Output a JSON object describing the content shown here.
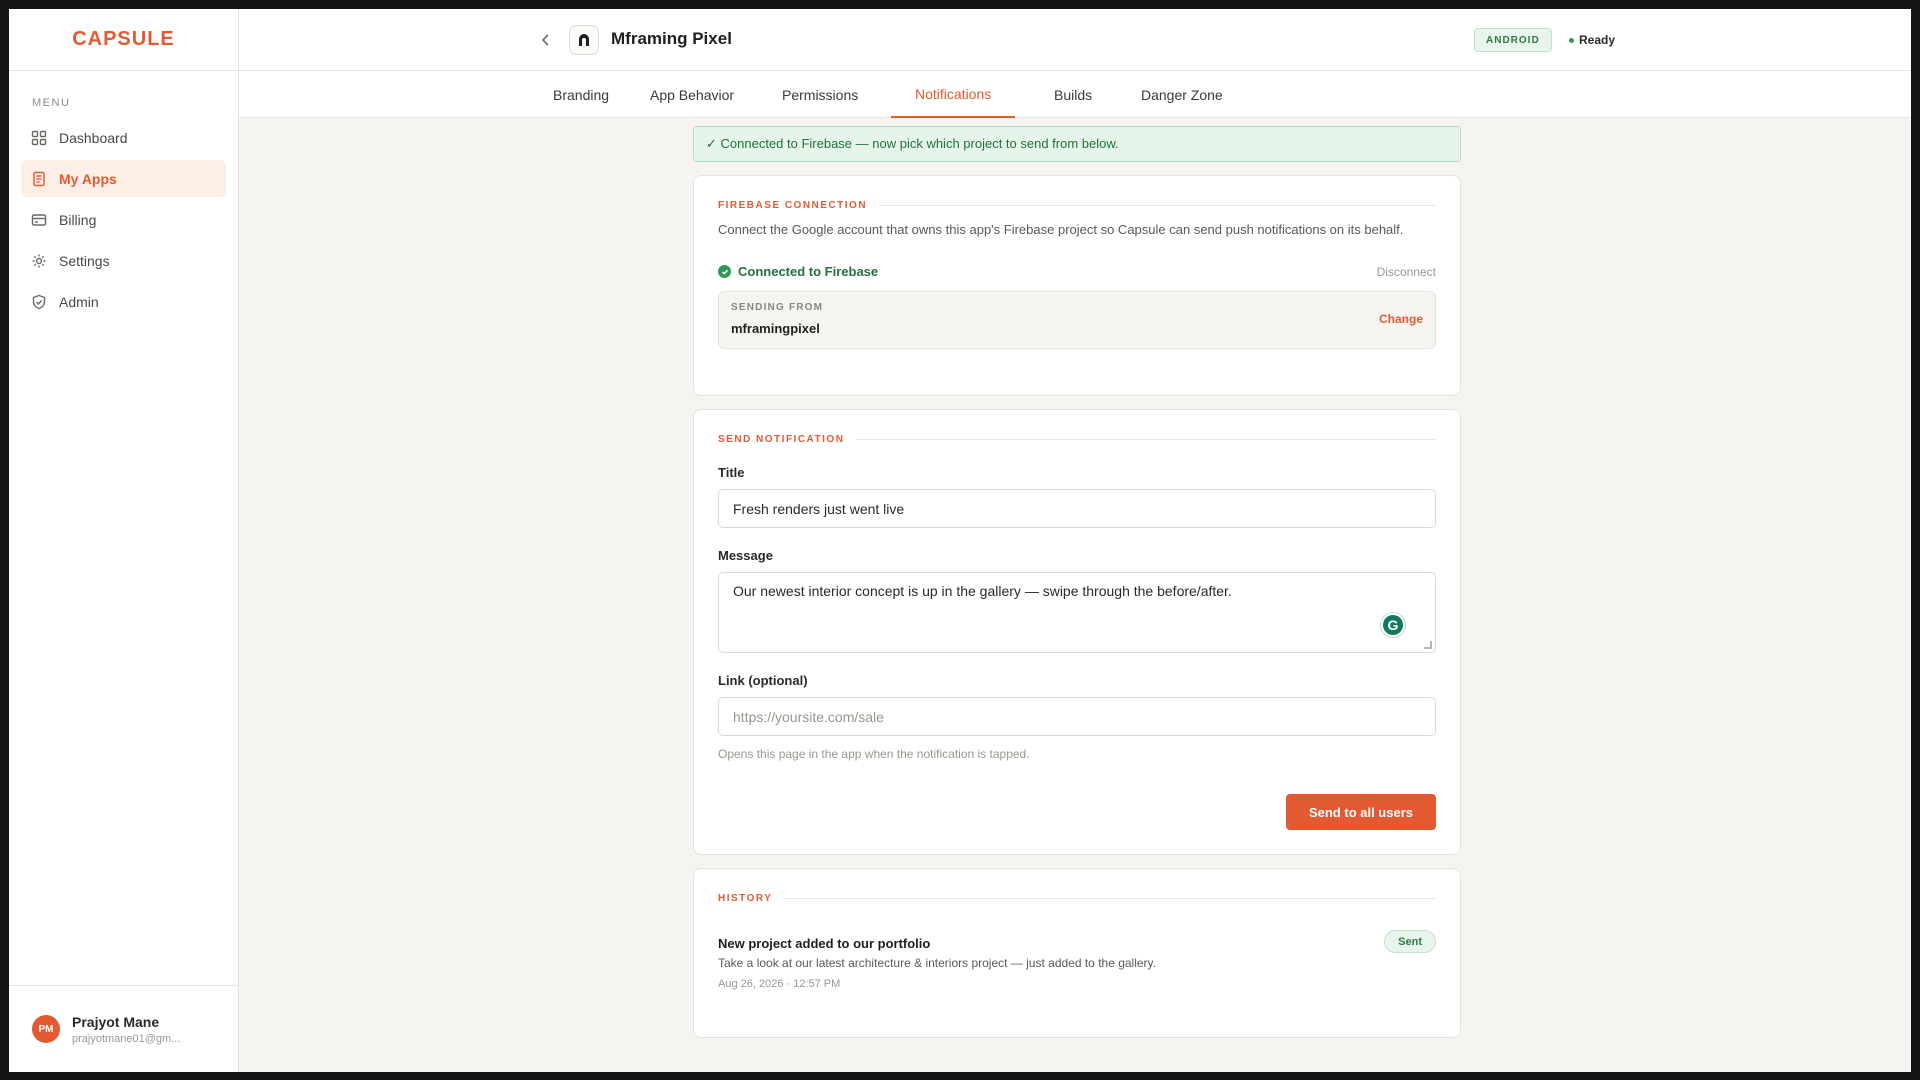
{
  "brand": "CAPSULE",
  "sidebar": {
    "menu_label": "MENU",
    "items": [
      {
        "label": "Dashboard",
        "icon": "grid-icon"
      },
      {
        "label": "My Apps",
        "icon": "document-icon"
      },
      {
        "label": "Billing",
        "icon": "card-icon"
      },
      {
        "label": "Settings",
        "icon": "gear-icon"
      },
      {
        "label": "Admin",
        "icon": "shield-icon"
      }
    ],
    "active": "My Apps",
    "user": {
      "initials": "PM",
      "name": "Prajyot Mane",
      "email": "prajyotmane01@gm..."
    }
  },
  "header": {
    "app_name": "Mframing Pixel",
    "platform": "ANDROID",
    "status": "Ready"
  },
  "tabs": [
    "Branding",
    "App Behavior",
    "Permissions",
    "Notifications",
    "Builds",
    "Danger Zone"
  ],
  "active_tab": "Notifications",
  "banner": "✓ Connected to Firebase — now pick which project to send from below.",
  "firebase": {
    "section_title": "FIREBASE CONNECTION",
    "description": "Connect the Google account that owns this app's Firebase project so Capsule can send push notifications on its behalf.",
    "connected_label": "Connected to Firebase",
    "disconnect_label": "Disconnect",
    "sending_from_label": "SENDING FROM",
    "sending_from_value": "mframingpixel",
    "change_label": "Change"
  },
  "send": {
    "section_title": "SEND NOTIFICATION",
    "title_label": "Title",
    "title_value": "Fresh renders just went live",
    "message_label": "Message",
    "message_value": "Our newest interior concept is up in the gallery — swipe through the before/after.",
    "link_label": "Link (optional)",
    "link_placeholder": "https://yoursite.com/sale",
    "link_hint": "Opens this page in the app when the notification is tapped.",
    "button_label": "Send to all users"
  },
  "history": {
    "section_title": "HISTORY",
    "items": [
      {
        "title": "New project added to our portfolio",
        "body": "Take a look at our latest architecture & interiors project — just added to the gallery.",
        "time": "Aug 26, 2026 · 12:57 PM",
        "status": "Sent"
      }
    ]
  },
  "colors": {
    "accent": "#e35a32",
    "success": "#2f9a54",
    "background": "#f5f4f1"
  }
}
